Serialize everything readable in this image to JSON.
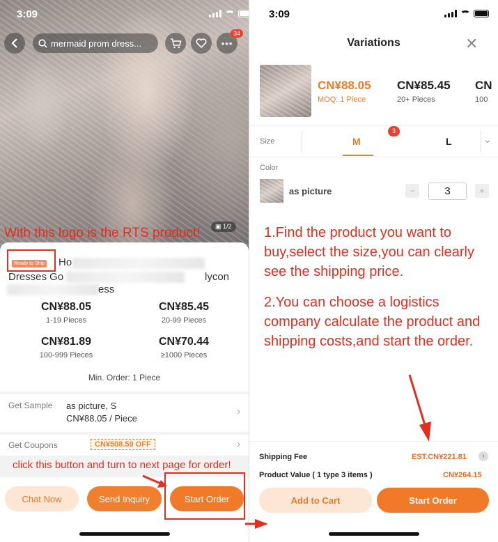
{
  "left": {
    "status_time": "3:09",
    "search_text": "mermaid prom dress...",
    "cart_badge": "34",
    "image_counter": "1/2",
    "rts_annotation": "With this logo is the RTS product!",
    "rts_badge": "Ready to Ship",
    "title_partial": "Ho",
    "title_line2_left": "Dresses Go",
    "title_line2_right": "lycon",
    "title_line3": "ess",
    "price_tiers": [
      {
        "price": "CN¥88.05",
        "qty": "1-19 Pieces"
      },
      {
        "price": "CN¥85.45",
        "qty": "20-99 Pieces"
      },
      {
        "price": "CN¥81.89",
        "qty": "100-999 Pieces"
      },
      {
        "price": "CN¥70.44",
        "qty": "≥1000 Pieces"
      }
    ],
    "min_order": "Min. Order: 1 Piece",
    "sample": {
      "label": "Get Sample",
      "line1": "as picture, S",
      "line2": "CN¥88.05 / Piece"
    },
    "coupons": {
      "label": "Get Coupons",
      "value": "CN¥508.59 OFF"
    },
    "click_annotation": "click this button and turn to next page for order!",
    "buttons": {
      "chat": "Chat Now",
      "inquiry": "Send Inquiry",
      "start": "Start Order"
    }
  },
  "right": {
    "status_time": "3:09",
    "title": "Variations",
    "price_tiers": [
      {
        "price": "CN¥88.05",
        "qty": "MOQ: 1 Piece"
      },
      {
        "price": "CN¥85.45",
        "qty": "20+ Pieces"
      },
      {
        "price": "CN",
        "qty": "100"
      }
    ],
    "size": {
      "label": "Size",
      "selected": "M",
      "badge": "3",
      "other": "L"
    },
    "color": {
      "label": "Color",
      "name": "as picture",
      "qty": "3"
    },
    "step1": "1.Find the product you want to buy,select the size,you can clearly see the shipping price.",
    "step2": "2.You can choose a logistics company calculate the product and shipping costs,and start the order.",
    "shipping_label": "Shipping Fee",
    "shipping_value": "EST.CN¥221.81",
    "product_value_label": "Product Value ( 1 type 3 items )",
    "product_value": "CN¥264.15",
    "buttons": {
      "cart": "Add to Cart",
      "start": "Start Order"
    }
  },
  "colors": {
    "accent": "#f07a28",
    "annotation": "#e32d1e"
  }
}
